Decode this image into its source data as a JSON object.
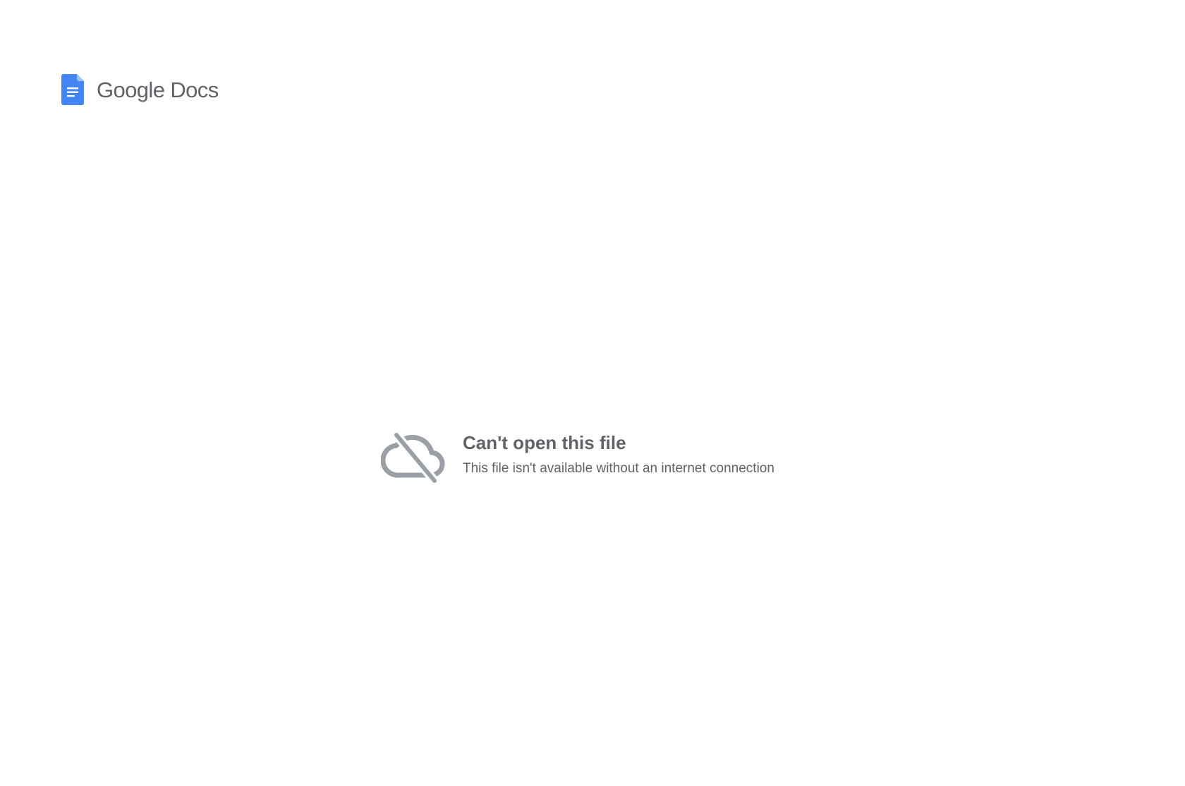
{
  "header": {
    "logo_icon": "google-docs-icon",
    "brand_word": "Google",
    "product_word": "Docs",
    "accent_color": "#4285f4"
  },
  "error": {
    "icon": "cloud-off-icon",
    "title": "Can't open this file",
    "message": "This file isn't available without an internet connection",
    "text_color": "#5f6368",
    "icon_color": "#9aa0a6"
  }
}
